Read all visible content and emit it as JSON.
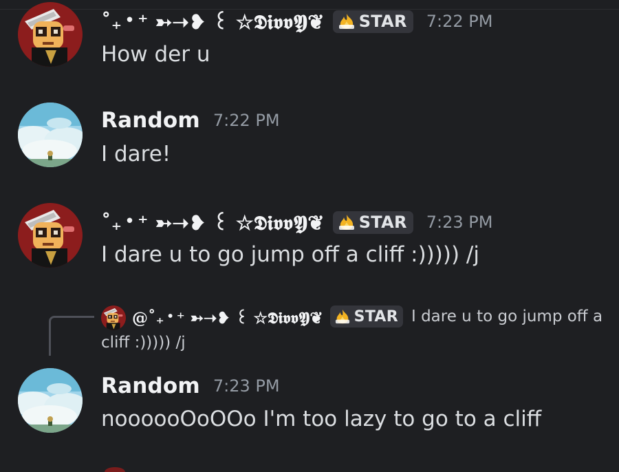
{
  "colors": {
    "background": "#1e1f22",
    "username": "#f2f3f5",
    "timestamp": "#949ba4",
    "message_text": "#dbdee1",
    "tag_background": "#34353b",
    "reply_line": "#4e5058"
  },
  "messages": [
    {
      "author": "˚₊‧⁺ ➳➝❥ ꒰ ☆𝕯𝖎𝖛𝖛𝖄❦",
      "avatar_icon": "anime-character-avatar",
      "tag": {
        "icon": "flame-icon",
        "label": "STAR"
      },
      "time": "7:22 PM",
      "text": "How der u"
    },
    {
      "author": "Random",
      "avatar_icon": "sky-clouds-avatar",
      "time": "7:22 PM",
      "text": "I dare!"
    },
    {
      "author": "˚₊‧⁺ ➳➝❥ ꒰ ☆𝕯𝖎𝖛𝖛𝖄❦",
      "avatar_icon": "anime-character-avatar",
      "tag": {
        "icon": "flame-icon",
        "label": "STAR"
      },
      "time": "7:23 PM",
      "text": "I dare u to go jump off a cliff :))))) /j"
    },
    {
      "author": "Random",
      "avatar_icon": "sky-clouds-avatar",
      "time": "7:23 PM",
      "text": "noooooOoOOo I'm too lazy to go to a cliff",
      "reply": {
        "author": "@˚₊‧⁺ ➳➝❥ ꒰ ☆𝕯𝖎𝖛𝖛𝖄❦",
        "tag": {
          "icon": "flame-icon",
          "label": "STAR"
        },
        "text_line1": "I dare u to go jump off a",
        "text_line2": "cliff :))))) /j"
      }
    }
  ]
}
